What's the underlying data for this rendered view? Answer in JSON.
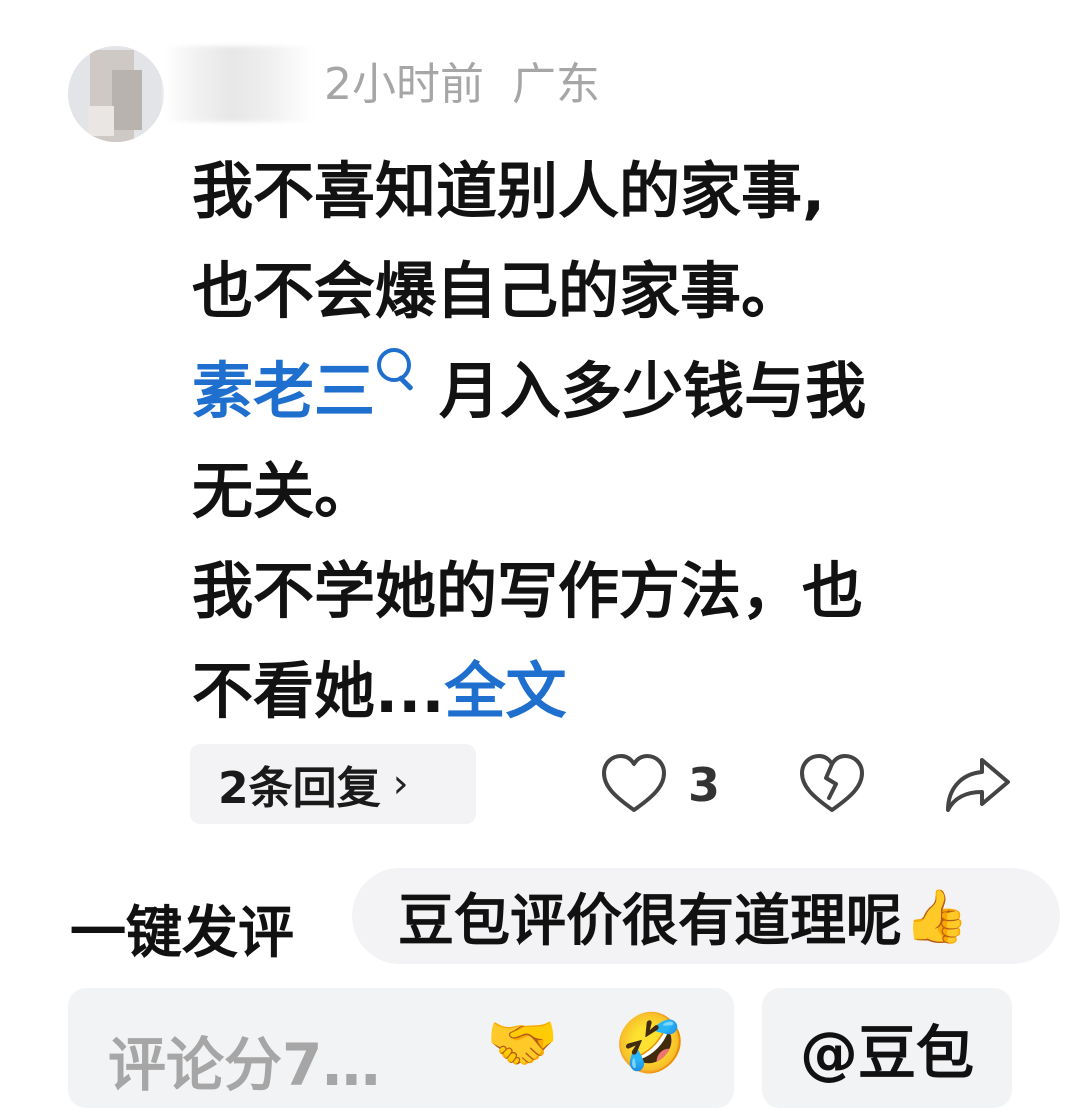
{
  "comment": {
    "time": "2小时前",
    "location": "广东",
    "line1": "我不喜知道别人的家事,",
    "line2": "也不会爆自己的家事。",
    "mention": "素老三",
    "line3_rest": "月入多少钱与我",
    "line4": "无关。",
    "line5": "我不学她的写作方法，也",
    "line6_prefix": "不看她...",
    "expand": "全文"
  },
  "actions": {
    "replies": "2条回复",
    "replies_chevron": "›",
    "like_count": "3"
  },
  "quick_comment": {
    "label": "一键发评",
    "suggestion": "豆包评价很有道理呢",
    "suggestion_emoji": "👍"
  },
  "input_bar": {
    "placeholder": "评论分7…",
    "emoji1": "🤝",
    "emoji2": "🤣",
    "ask": "@豆包"
  },
  "icons": [
    "heart-icon",
    "broken-heart-icon",
    "share-icon",
    "search-icon"
  ],
  "colors": {
    "link": "#1f6fcf",
    "meta": "#a6a6a6",
    "chip_bg": "#f3f3f5"
  }
}
